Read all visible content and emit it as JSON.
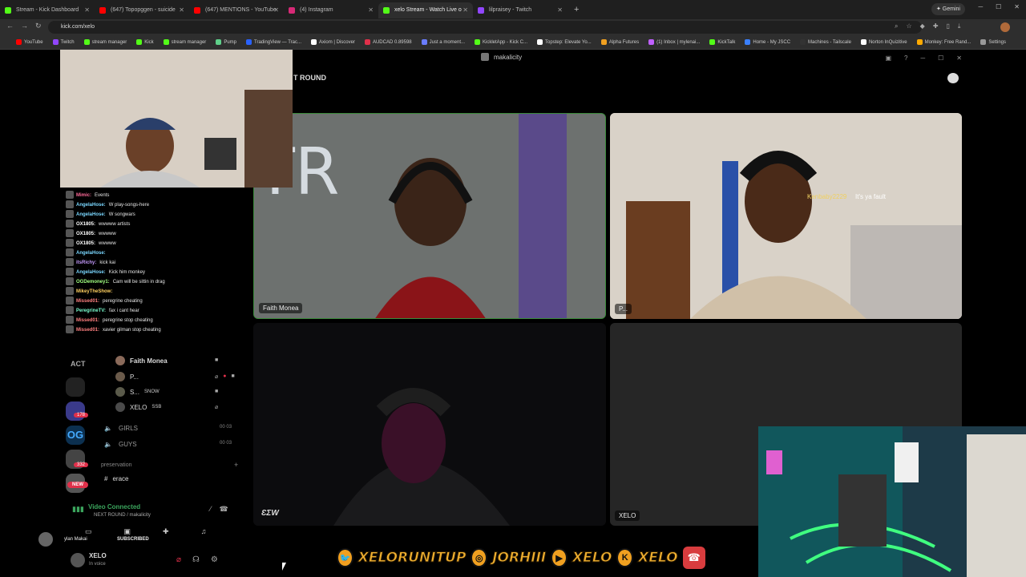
{
  "browser": {
    "tabs": [
      {
        "label": "Stream - Kick Dashboard",
        "color": "#53fc18",
        "active": false
      },
      {
        "label": "(647) Topopggen - suicide",
        "color": "#ff0000",
        "active": false
      },
      {
        "label": "(647) MENTIONS - YouTube",
        "color": "#ff0000",
        "active": false
      },
      {
        "label": "(4) Instagram",
        "color": "#d62976",
        "active": false
      },
      {
        "label": "xelo Stream - Watch Live o",
        "color": "#53fc18",
        "active": true
      },
      {
        "label": "lilpraisey - Twitch",
        "color": "#9146ff",
        "active": false
      }
    ],
    "new_tab": "+",
    "gemini": "✦ Gemini",
    "url": "kick.com/xelo",
    "bookmarks": [
      {
        "label": "YouTube",
        "color": "#ff0000"
      },
      {
        "label": "Twitch",
        "color": "#9146ff"
      },
      {
        "label": "stream manager",
        "color": "#53fc18"
      },
      {
        "label": "Kick",
        "color": "#53fc18"
      },
      {
        "label": "stream manager",
        "color": "#53fc18"
      },
      {
        "label": "Pump",
        "color": "#5fd08a"
      },
      {
        "label": "TradingView — Trac...",
        "color": "#2962ff"
      },
      {
        "label": "Axiom | Discover",
        "color": "#ffffff"
      },
      {
        "label": "AUDCAD 0.89598",
        "color": "#e0304a"
      },
      {
        "label": "Just a moment...",
        "color": "#6a7dff"
      },
      {
        "label": "KickletApp - Kick C...",
        "color": "#53fc18"
      },
      {
        "label": "Topstep: Elevate Yo...",
        "color": "#ffffff"
      },
      {
        "label": "Alpha Futures",
        "color": "#f0a020"
      },
      {
        "label": "(1) Inbox | mylenai...",
        "color": "#c060ff"
      },
      {
        "label": "KickTalk",
        "color": "#53fc18"
      },
      {
        "label": "Home - My JSCC",
        "color": "#3a80ff"
      },
      {
        "label": "Machines - Tailscale",
        "color": "#333333"
      },
      {
        "label": "Norton InQuizitive",
        "color": "#ffffff"
      },
      {
        "label": "Monkey: Free Rand...",
        "color": "#ffaa00"
      },
      {
        "label": "Settings",
        "color": "#999999"
      }
    ]
  },
  "call": {
    "title": "makalicity",
    "round_label": "T ROUND",
    "tiles": [
      {
        "name": "Faith Monea"
      },
      {
        "name": "P..."
      },
      {
        "name": ""
      },
      {
        "name": "XELO"
      }
    ],
    "overlay_caption": {
      "user": "Kenbaby2229",
      "text": "It's ya fault"
    }
  },
  "chat": [
    {
      "user": "Mimic:",
      "text": "Events",
      "color": "#ff6b9a"
    },
    {
      "user": "AngelaHose:",
      "text": "W   play-songs-here",
      "color": "#7ad7ff"
    },
    {
      "user": "AngelaHose:",
      "text": "W   songwars",
      "color": "#7ad7ff"
    },
    {
      "user": "OX1805:",
      "text": "wwwww   artists",
      "color": "#ffffff"
    },
    {
      "user": "OX1805:",
      "text": "wwwww",
      "color": "#ffffff"
    },
    {
      "user": "OX1805:",
      "text": "wwwww",
      "color": "#ffffff"
    },
    {
      "user": "AngelaHose:",
      "text": "",
      "color": "#7ad7ff"
    },
    {
      "user": "itsRichy:",
      "text": "kick kai",
      "color": "#c69cff"
    },
    {
      "user": "AngelaHose:",
      "text": "Kick him monkey",
      "color": "#7ad7ff"
    },
    {
      "user": "OGDemoney1:",
      "text": "Cam will be sittin in drag",
      "color": "#a0ff80"
    },
    {
      "user": "MikeyTheShow:",
      "text": "",
      "color": "#ffd060"
    },
    {
      "user": "Missed01:",
      "text": "peregrine cheating",
      "color": "#ff8080"
    },
    {
      "user": "PeregrineTV:",
      "text": "fax i cant hear",
      "color": "#7affd0"
    },
    {
      "user": "Missed01:",
      "text": "peregrine stop cheating",
      "color": "#ff8080"
    },
    {
      "user": "Missed01:",
      "text": "xavier gilman stop cheating",
      "color": "#ff8080"
    }
  ],
  "discord": {
    "section_label": "ACT",
    "members": [
      {
        "name": "Faith Monea",
        "tag": ""
      },
      {
        "name": "P...",
        "tag": ""
      },
      {
        "name": "S...",
        "tag": "SNOW"
      },
      {
        "name": "XELO",
        "tag": "SSB"
      }
    ],
    "voice_channels": [
      {
        "name": "GIRLS",
        "count_a": "00",
        "count_b": "03"
      },
      {
        "name": "GUYS",
        "count_a": "00",
        "count_b": "03"
      }
    ],
    "category": "preservation",
    "text_channel": "erace",
    "new_badge": "NEW",
    "server_badges": [
      "178",
      "332"
    ],
    "voice_status": "Video Connected",
    "voice_sub": "NEXT ROUND / makalicity",
    "user": {
      "name": "XELO",
      "status": "In voice"
    },
    "sub_name": "ylan Makai",
    "sub_label": "SUBSCRIBED"
  },
  "socials": [
    {
      "icon": "twitter-icon",
      "glyph": "🐦",
      "handle": "XELORUNITUP"
    },
    {
      "icon": "instagram-icon",
      "glyph": "◎",
      "handle": "JORHIII"
    },
    {
      "icon": "youtube-icon",
      "glyph": "▶",
      "handle": "XELO"
    },
    {
      "icon": "kick-icon",
      "glyph": "K",
      "handle": "XELO"
    }
  ]
}
